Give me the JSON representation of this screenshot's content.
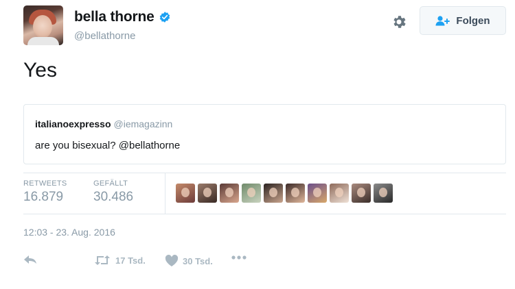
{
  "header": {
    "display_name": "bella thorne",
    "handle": "@bellathorne",
    "verified_icon": "verified-badge-icon",
    "follow_label": "Folgen",
    "accent": "#1da1f2"
  },
  "tweet": {
    "text": "Yes",
    "quoted": {
      "name": "italianoexpresso",
      "handle": "@iemagazinn",
      "text": "are you bisexual? @bellathorne"
    },
    "stats": [
      {
        "label": "RETWEETS",
        "value": "16.879"
      },
      {
        "label": "GEFÄLLT",
        "value": "30.486"
      }
    ],
    "likers": [
      {
        "color_a": "#c48a6a",
        "color_b": "#6d3c3a"
      },
      {
        "color_a": "#9a7a6a",
        "color_b": "#3a2a24"
      },
      {
        "color_a": "#5a3a36",
        "color_b": "#d9a78e"
      },
      {
        "color_a": "#6f8a6a",
        "color_b": "#c9d3bf"
      },
      {
        "color_a": "#2a2220",
        "color_b": "#caa58e"
      },
      {
        "color_a": "#3c2a28",
        "color_b": "#e0b79b"
      },
      {
        "color_a": "#6b4e8a",
        "color_b": "#d8a86a"
      },
      {
        "color_a": "#8e6a5a",
        "color_b": "#efe1d6"
      },
      {
        "color_a": "#a98a7e",
        "color_b": "#3b2e2a"
      },
      {
        "color_a": "#8a8a8a",
        "color_b": "#2a2a2a"
      }
    ],
    "timestamp": "12:03 - 23. Aug. 2016",
    "actions": {
      "retweet_count": "17 Tsd.",
      "like_count": "30 Tsd."
    }
  }
}
